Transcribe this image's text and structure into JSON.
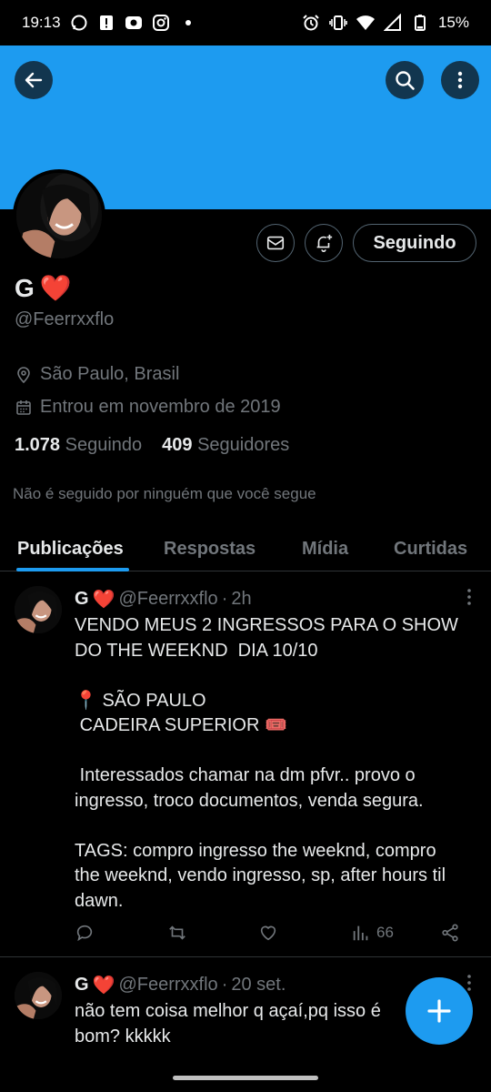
{
  "status_bar": {
    "time": "19:13",
    "battery": "15%",
    "left_icons": [
      "whatsapp-icon",
      "alert-icon",
      "youtube-icon",
      "instagram-icon",
      "dot-icon"
    ],
    "right_icons": [
      "alarm-icon",
      "vibrate-icon",
      "wifi-icon",
      "signal-icon",
      "battery-icon"
    ]
  },
  "colors": {
    "banner": "#1d9bf0",
    "accent": "#1d9bf0",
    "background": "#000000",
    "secondary_text": "#71767b",
    "heart": "#e0245e"
  },
  "profile": {
    "name": "G",
    "name_emoji": "❤️",
    "handle": "@Feerrxxflo",
    "location": "São Paulo, Brasil",
    "joined": "Entrou em novembro de 2019",
    "following_count": "1.078",
    "following_label": "Seguindo",
    "followers_count": "409",
    "followers_label": "Seguidores",
    "not_followed": "Não é seguido por ninguém que você segue",
    "follow_button": "Seguindo"
  },
  "tabs": [
    {
      "label": "Publicações",
      "active": true
    },
    {
      "label": "Respostas",
      "active": false
    },
    {
      "label": "Mídia",
      "active": false
    },
    {
      "label": "Curtidas",
      "active": false
    }
  ],
  "posts": [
    {
      "name": "G",
      "heart": "❤️",
      "handle": "@Feerrxxflo",
      "dot": "·",
      "time": "2h",
      "lines": [
        "VENDO MEUS 2 INGRESSOS PARA O SHOW",
        "DO THE WEEKND  DIA 10/10",
        "",
        "📍 SÃO PAULO",
        " CADEIRA SUPERIOR 🎟️",
        "",
        " Interessados chamar na dm pfvr.. provo o",
        "ingresso, troco documentos, venda segura.",
        "",
        "TAGS: compro ingresso the weeknd, compro",
        "the weeknd, vendo ingresso, sp, after hours til",
        "dawn."
      ],
      "views": "66"
    },
    {
      "name": "G",
      "heart": "❤️",
      "handle": "@Feerrxxflo",
      "dot": "·",
      "time": "20 set.",
      "lines": [
        "não tem coisa melhor q açaí,pq isso é",
        "bom? kkkkk"
      ]
    }
  ]
}
